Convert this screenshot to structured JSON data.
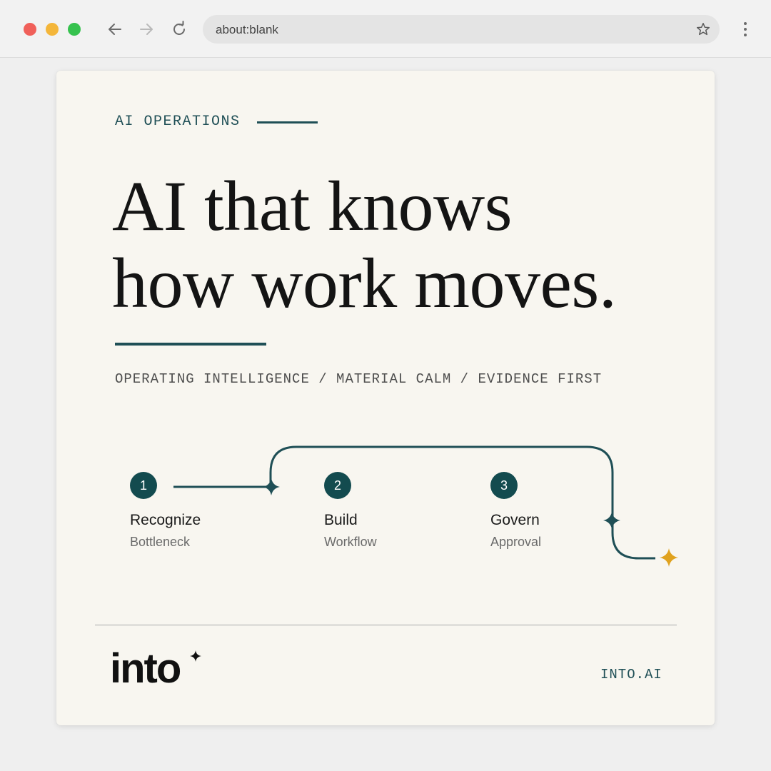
{
  "browser": {
    "url": "about:blank",
    "icons": {
      "back": "arrow-left-icon",
      "forward": "arrow-right-icon",
      "reload": "reload-icon",
      "bookmark": "star-icon",
      "menu": "kebab-menu-icon"
    }
  },
  "card": {
    "eyebrow": "AI OPERATIONS",
    "headline_line1": "AI that knows",
    "headline_line2": "how work moves.",
    "tagline": "OPERATING INTELLIGENCE / MATERIAL CALM / EVIDENCE FIRST",
    "steps": [
      {
        "number": "1",
        "title": "Recognize",
        "subtitle": "Bottleneck"
      },
      {
        "number": "2",
        "title": "Build",
        "subtitle": "Workflow"
      },
      {
        "number": "3",
        "title": "Govern",
        "subtitle": "Approval"
      }
    ],
    "logo_text": "into",
    "site": "INTO.AI"
  },
  "colors": {
    "accent_teal": "#1f4f56",
    "step_circle": "#134b4f",
    "spark_gold": "#e0a21e",
    "card_bg": "#f8f6f0"
  }
}
